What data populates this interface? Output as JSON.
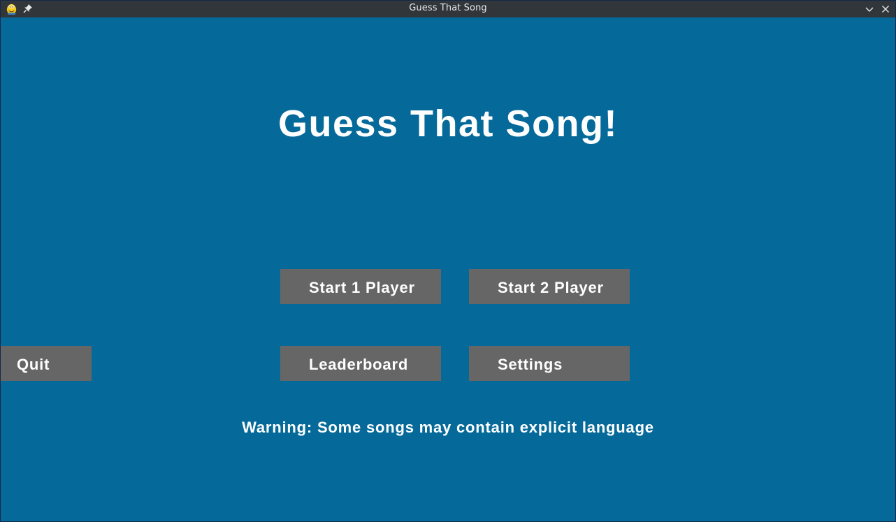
{
  "window": {
    "title": "Guess That Song",
    "icons": {
      "app": "pygame-snake-icon",
      "pin": "pin-icon",
      "minimize": "chevron-down-icon",
      "close": "close-icon"
    }
  },
  "menu": {
    "title": "Guess That Song!",
    "buttons": {
      "start_1_player": "Start 1 Player",
      "start_2_player": "Start 2 Player",
      "leaderboard": "Leaderboard",
      "settings": "Settings",
      "quit": "Quit"
    },
    "warning": "Warning: Some songs may contain explicit language"
  },
  "colors": {
    "background": "#056a99",
    "button": "#666666",
    "text": "#ffffff",
    "titlebar": "#31363b"
  }
}
